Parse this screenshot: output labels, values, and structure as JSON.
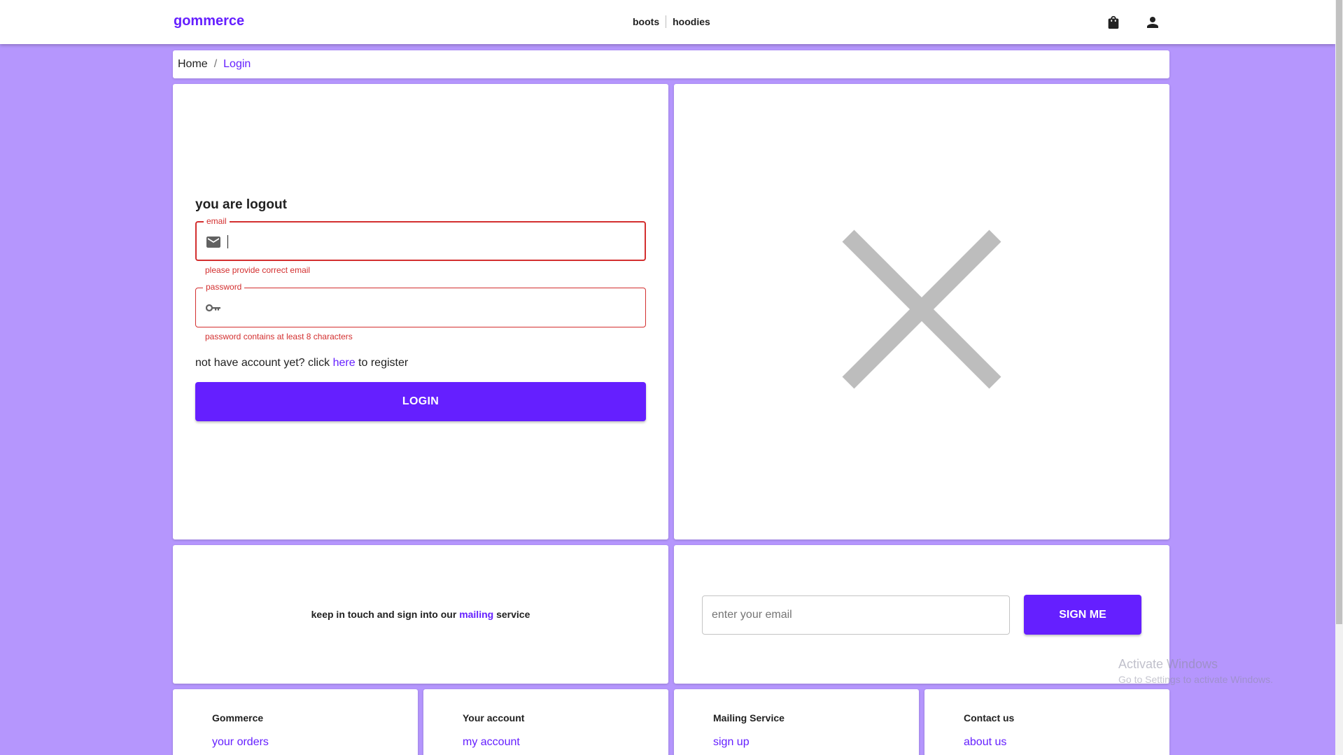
{
  "header": {
    "brand": "gommerce",
    "nav": [
      "boots",
      "hoodies"
    ],
    "icons": [
      "shopping-bag-icon",
      "person-icon"
    ]
  },
  "breadcrumb": {
    "home": "Home",
    "separator": "/",
    "current": "Login"
  },
  "login": {
    "heading": "you are logout",
    "email": {
      "label": "email",
      "value": "",
      "error": "please provide correct email",
      "icon": "mail-icon"
    },
    "password": {
      "label": "password",
      "value": "",
      "error": "password contains at least 8 characters",
      "icon": "key-icon"
    },
    "register": {
      "prefix": "not have account yet? click",
      "link": "here",
      "suffix": "to register"
    },
    "button": "LOGIN"
  },
  "image_placeholder": {
    "icon": "close-icon"
  },
  "mailing": {
    "text_prefix": "keep in touch and sign into our",
    "text_accent": "mailing",
    "text_suffix": "service",
    "input_placeholder": "enter your email",
    "button": "SIGN ME"
  },
  "footer": {
    "columns": [
      {
        "title": "Gommerce",
        "link": "your orders"
      },
      {
        "title": "Your account",
        "link": "my account"
      },
      {
        "title": "Mailing Service",
        "link": "sign up"
      },
      {
        "title": "Contact us",
        "link": "about us"
      }
    ]
  },
  "watermark": {
    "title": "Activate Windows",
    "subtitle": "Go to Settings to activate Windows."
  },
  "colors": {
    "accent": "#651fff",
    "background": "#b596fd",
    "error": "#d32f2f",
    "card": "#ffffff"
  }
}
